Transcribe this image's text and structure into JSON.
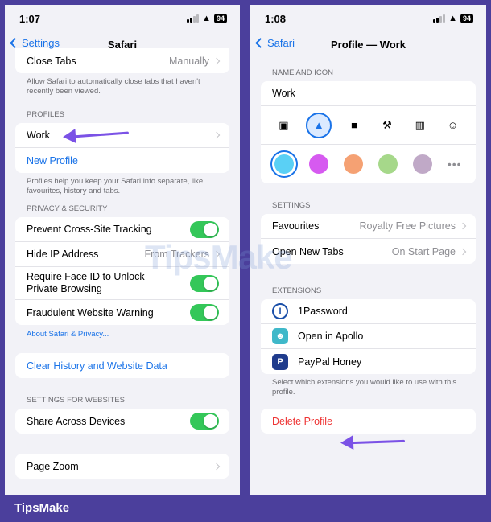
{
  "left": {
    "status": {
      "time": "1:07",
      "battery": "94"
    },
    "nav": {
      "back_label": "Settings",
      "title": "Safari"
    },
    "close_tabs": {
      "label": "Close Tabs",
      "value": "Manually"
    },
    "close_tabs_footnote": "Allow Safari to automatically close tabs that haven't recently been viewed.",
    "profiles_header": "PROFILES",
    "profiles": {
      "work": "Work",
      "new_profile": "New Profile"
    },
    "profiles_footnote": "Profiles help you keep your Safari info separate, like favourites, history and tabs.",
    "privacy_header": "PRIVACY & SECURITY",
    "privacy": {
      "cross_site": "Prevent Cross-Site Tracking",
      "hide_ip": "Hide IP Address",
      "hide_ip_value": "From Trackers",
      "face_id": "Require Face ID to Unlock Private Browsing",
      "fraudulent": "Fraudulent Website Warning"
    },
    "about_link": "About Safari & Privacy...",
    "clear_history": "Clear History and Website Data",
    "websites_header": "SETTINGS FOR WEBSITES",
    "share_devices": "Share Across Devices",
    "page_zoom": "Page Zoom"
  },
  "right": {
    "status": {
      "time": "1:08",
      "battery": "94"
    },
    "nav": {
      "back_label": "Safari",
      "title": "Profile — Work"
    },
    "name_header": "NAME AND ICON",
    "profile_name": "Work",
    "icons": [
      "person-badge-icon",
      "graduation-cap-icon",
      "briefcase-icon",
      "hammer-icon",
      "building-icon",
      "smiley-icon"
    ],
    "colors": [
      "#5ad0f5",
      "#d65af0",
      "#f5a173",
      "#a6d88a",
      "#c0a9c7"
    ],
    "settings_header": "SETTINGS",
    "favourites": {
      "label": "Favourites",
      "value": "Royalty Free Pictures"
    },
    "open_new_tabs": {
      "label": "Open New Tabs",
      "value": "On Start Page"
    },
    "extensions_header": "EXTENSIONS",
    "extensions": [
      "1Password",
      "Open in Apollo",
      "PayPal Honey"
    ],
    "extensions_footnote": "Select which extensions you would like to use with this profile.",
    "delete_profile": "Delete Profile"
  },
  "watermark": "TipsMake",
  "brand": "TipsMake",
  "accent": "#1a73e8",
  "toggle_color": "#34c759",
  "arrow_color": "#7b52e6"
}
